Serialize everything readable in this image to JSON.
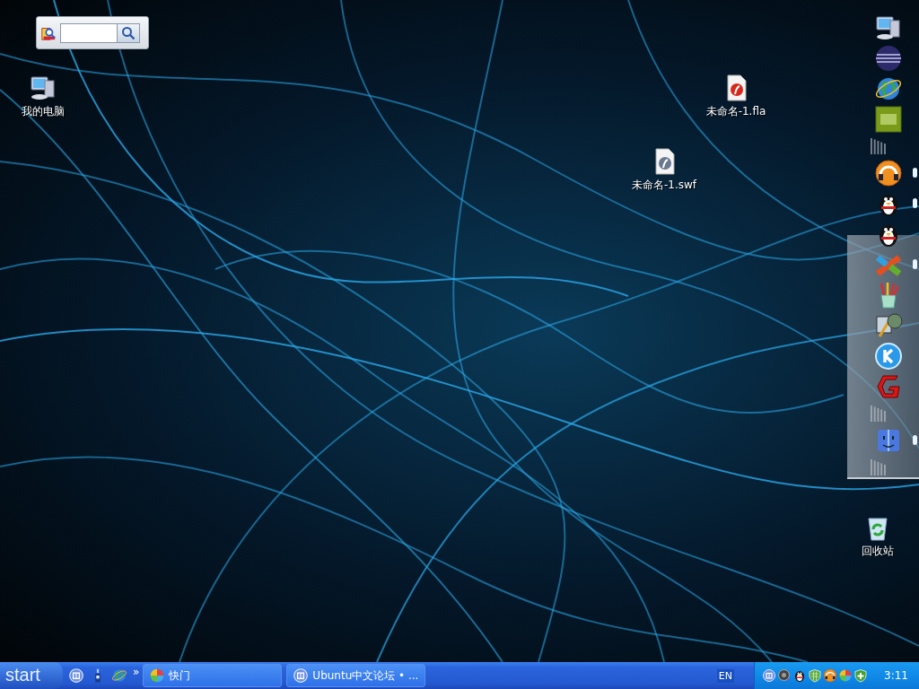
{
  "desktop_icons": [
    {
      "kind": "computer",
      "label": "我的电脑"
    },
    {
      "kind": "fla",
      "label": "未命名-1.fla"
    },
    {
      "kind": "swf",
      "label": "未命名-1.swf"
    },
    {
      "kind": "recycle",
      "label": "回收站"
    }
  ],
  "dock": {
    "items": [
      {
        "kind": "computer",
        "running": false
      },
      {
        "kind": "sphere",
        "running": false
      },
      {
        "kind": "globe",
        "running": false
      },
      {
        "kind": "dw",
        "running": false
      },
      {
        "kind": "separator",
        "running": false
      },
      {
        "kind": "headphones",
        "running": true
      },
      {
        "kind": "penguin",
        "running": true
      },
      {
        "kind": "penguin",
        "running": false
      },
      {
        "kind": "infinity",
        "running": true
      },
      {
        "kind": "brushes",
        "running": false
      },
      {
        "kind": "fxp",
        "running": false
      },
      {
        "kind": "k",
        "running": false
      },
      {
        "kind": "g",
        "running": false
      },
      {
        "kind": "separator",
        "running": false
      },
      {
        "kind": "face",
        "running": true
      },
      {
        "kind": "separator",
        "running": false
      }
    ]
  },
  "taskbar": {
    "start": "start",
    "quick_launch": [
      {
        "kind": "browser-circle"
      },
      {
        "kind": "bottle"
      },
      {
        "kind": "globe"
      }
    ],
    "more": "»",
    "tasks": [
      {
        "kind": "pinwheel",
        "label": "快门",
        "selected": false
      },
      {
        "kind": "browser-circle",
        "label": "Ubuntu中文论坛 • ...",
        "selected": false
      }
    ],
    "language": "EN",
    "tray": [
      {
        "kind": "browser-circle"
      },
      {
        "kind": "speaker"
      },
      {
        "kind": "penguin"
      },
      {
        "kind": "shield-grid"
      },
      {
        "kind": "headphones"
      },
      {
        "kind": "pinwheel"
      },
      {
        "kind": "shield-plus"
      }
    ],
    "clock": "3:11"
  }
}
